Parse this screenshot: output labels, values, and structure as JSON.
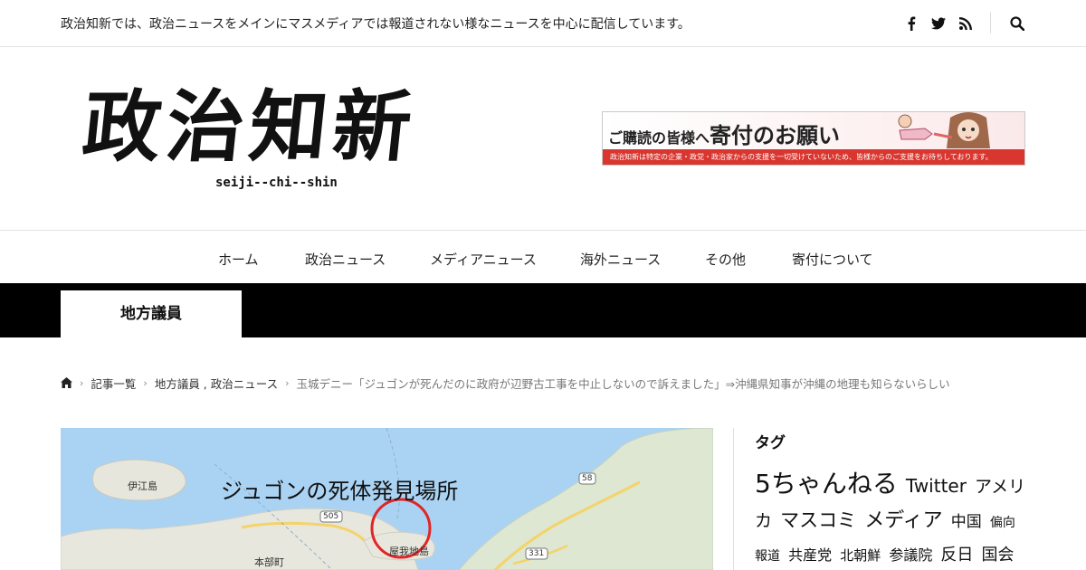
{
  "topbar": {
    "description": "政治知新では、政治ニュースをメインにマスメディアでは報道されない様なニュースを中心に配信しています。",
    "icons": [
      "facebook-icon",
      "twitter-icon",
      "rss-icon",
      "search-icon"
    ]
  },
  "header": {
    "logo_kanji": "政治知新",
    "logo_roman": "seiji--chi--shin",
    "banner": {
      "title_small": "ご購読の皆様へ",
      "title_large": "寄付のお願い",
      "strip": "政治知新は特定の企業・政党・政治家からの支援を一切受けていないため、皆様からのご支援をお待ちしております。"
    }
  },
  "nav": {
    "items": [
      "ホーム",
      "政治ニュース",
      "メディアニュース",
      "海外ニュース",
      "その他",
      "寄付について"
    ]
  },
  "category": {
    "label": "地方議員"
  },
  "breadcrumb": {
    "home_icon": "home-icon",
    "items": [
      "記事一覧",
      "地方議員 , 政治ニュース"
    ],
    "current": "玉城デニー「ジュゴンが死んだのに政府が辺野古工事を中止しないので訴えました」⇒沖縄県知事が沖縄の地理も知らないらしい"
  },
  "article_image": {
    "caption": "ジュゴンの死体発見場所",
    "labels": {
      "island": "伊江島",
      "route505": "505",
      "route58": "58",
      "route331": "331",
      "town": "本部町",
      "place": "屋我地島"
    }
  },
  "sidebar": {
    "heading": "タグ",
    "tags": [
      {
        "label": "5ちゃんねる",
        "size": 28
      },
      {
        "label": "Twitter",
        "size": 20
      },
      {
        "label": "アメリカ",
        "size": 19
      },
      {
        "label": "マスコミ",
        "size": 21
      },
      {
        "label": "メディア",
        "size": 22
      },
      {
        "label": "中国",
        "size": 17
      },
      {
        "label": "偏向報道",
        "size": 14
      },
      {
        "label": "共産党",
        "size": 16
      },
      {
        "label": "北朝鮮",
        "size": 15
      },
      {
        "label": "参議院",
        "size": 16
      },
      {
        "label": "反日",
        "size": 18
      },
      {
        "label": "国会",
        "size": 18
      }
    ]
  }
}
